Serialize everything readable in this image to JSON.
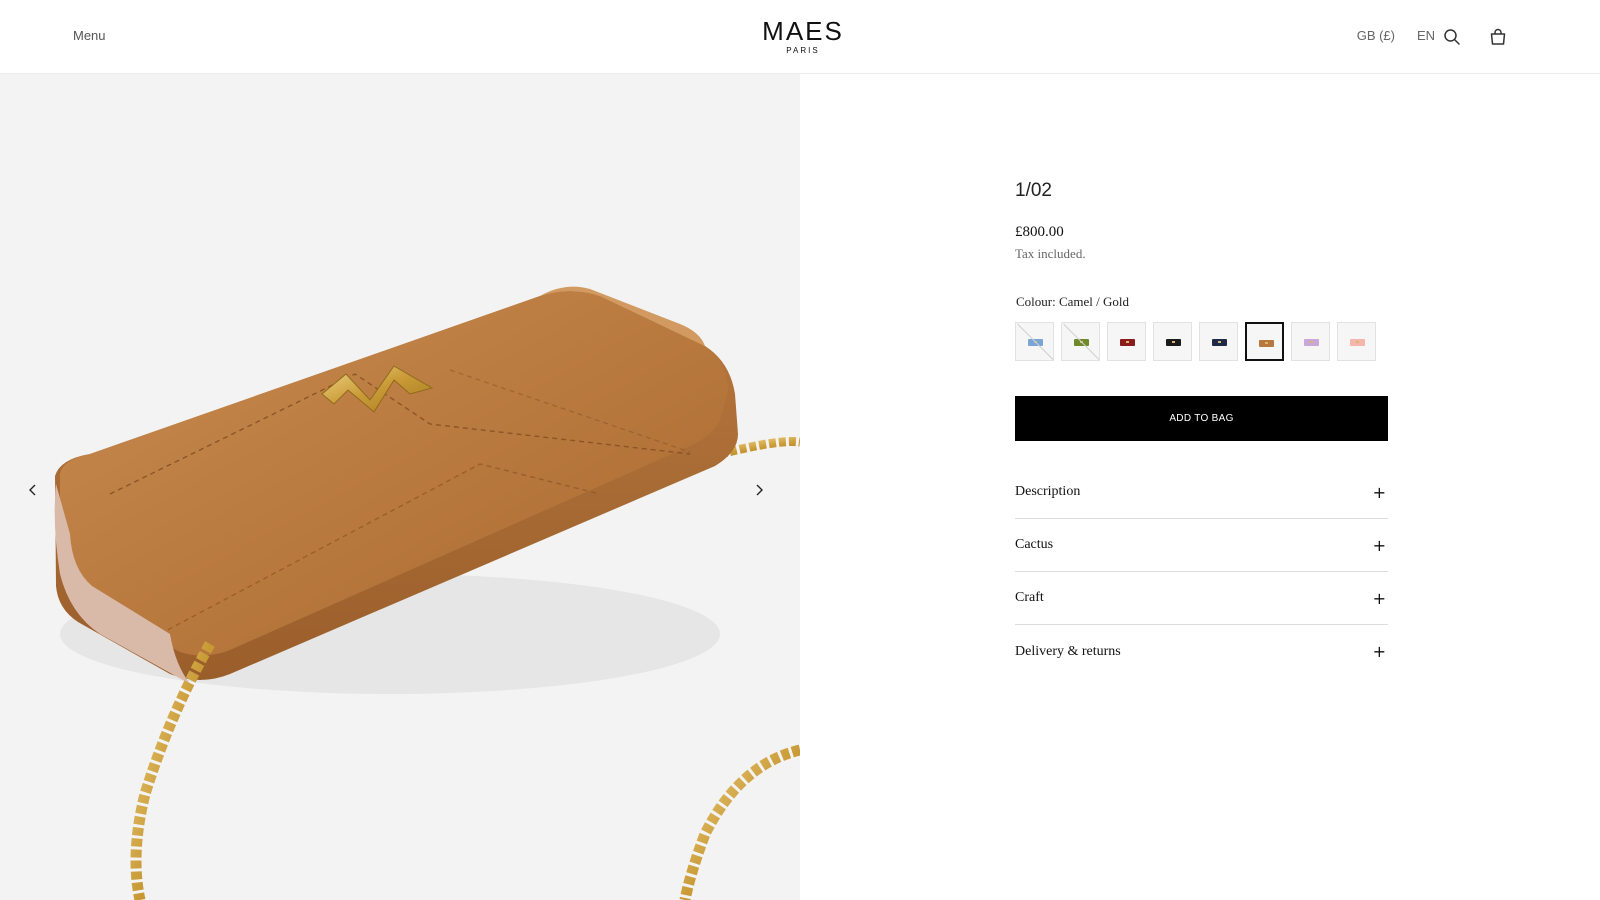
{
  "header": {
    "menu_label": "Menu",
    "logo_main": "MAES",
    "logo_sub": "PARIS",
    "currency": "GB (£)",
    "language": "EN",
    "icons": [
      "search-icon",
      "shopping-bag-icon"
    ]
  },
  "gallery": {
    "image_alt": "Camel leather clutch bag with gold chain and gold M clasp",
    "prev_icon": "chevron-left-icon",
    "next_icon": "chevron-right-icon"
  },
  "product": {
    "title": "1/02",
    "price": "£800.00",
    "tax_note": "Tax included.",
    "colour_label": "Colour: Camel / Gold",
    "swatches": [
      {
        "name": "Blue",
        "color": "#7aa6d6",
        "unavailable": true
      },
      {
        "name": "Green",
        "color": "#6f8a2a",
        "unavailable": true
      },
      {
        "name": "Red",
        "color": "#8a1c1c",
        "unavailable": false
      },
      {
        "name": "Black",
        "color": "#1b1b1b",
        "unavailable": false
      },
      {
        "name": "Navy",
        "color": "#1e2a48",
        "unavailable": false
      },
      {
        "name": "Camel",
        "color": "#b7773f",
        "unavailable": false,
        "selected": true
      },
      {
        "name": "Lilac",
        "color": "#c9a7d8",
        "unavailable": false
      },
      {
        "name": "Pink",
        "color": "#f3b5ac",
        "unavailable": false
      }
    ],
    "add_to_bag": "ADD TO BAG",
    "accordion": [
      {
        "label": "Description",
        "icon": "plus-icon"
      },
      {
        "label": "Cactus",
        "icon": "plus-icon"
      },
      {
        "label": "Craft",
        "icon": "plus-icon"
      },
      {
        "label": "Delivery & returns",
        "icon": "plus-icon"
      }
    ]
  },
  "colors": {
    "button_bg": "#000000",
    "gallery_bg": "#f3f3f3",
    "bag_camel": "#b7773f",
    "chain_gold": "#c99a36"
  }
}
